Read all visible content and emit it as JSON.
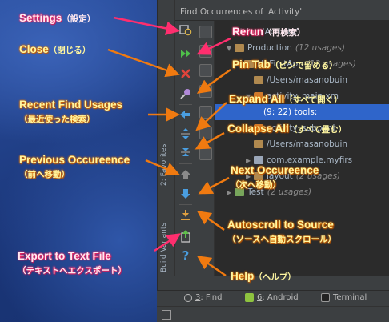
{
  "panel": {
    "title": "Find Occurrences of 'Activity'",
    "vertical_tabs": [
      "2: Favorites",
      "Build Variants"
    ]
  },
  "tree": {
    "rows": [
      {
        "indent": 1,
        "arrow": "",
        "icon": "none",
        "label": "String 'Activity'",
        "usage": "",
        "selected": false
      },
      {
        "indent": 1,
        "arrow": "▼",
        "icon": "folder",
        "label": "Production",
        "usage": "(12 usages)",
        "selected": false
      },
      {
        "indent": 2,
        "arrow": "▼",
        "icon": "folder",
        "label": "MyFirstApp",
        "usage": "(12 usages)",
        "selected": false
      },
      {
        "indent": 3,
        "arrow": "",
        "icon": "folder",
        "label": "/Users/masanobuin",
        "usage": "",
        "selected": false
      },
      {
        "indent": 3,
        "arrow": "▼",
        "icon": "file",
        "label": "activity_main.xm",
        "usage": "",
        "selected": false
      },
      {
        "indent": 4,
        "arrow": "",
        "icon": "none",
        "label": "(9: 22) tools:",
        "usage": "",
        "selected": true
      },
      {
        "indent": 3,
        "arrow": "▶",
        "icon": "file",
        "label": "activity_sub.xml",
        "usage": "",
        "selected": false
      },
      {
        "indent": 3,
        "arrow": "",
        "icon": "folder",
        "label": "/Users/masanobuin",
        "usage": "",
        "selected": false
      },
      {
        "indent": 3,
        "arrow": "▶",
        "icon": "pkg",
        "label": "com.example.myfirs",
        "usage": "",
        "selected": false
      },
      {
        "indent": 3,
        "arrow": "▶",
        "icon": "folder",
        "label": "layout",
        "usage": "(2 usages)",
        "selected": false
      },
      {
        "indent": 1,
        "arrow": "▶",
        "icon": "test",
        "label": "Test",
        "usage": "(2 usages)",
        "selected": false
      }
    ]
  },
  "bottom_tabs": [
    {
      "num": "3",
      "label": ": Find",
      "icon": "find-icon"
    },
    {
      "num": "6",
      "label": ": Android",
      "icon": "android-icon"
    },
    {
      "num": "",
      "label": "Terminal",
      "icon": "terminal-icon"
    }
  ],
  "toolbar_buttons": [
    {
      "name": "settings",
      "glyph": "⚙",
      "color": "#b9bcc0"
    },
    {
      "name": "rerun",
      "glyph": "▶▶",
      "color": "#4fbf4a"
    },
    {
      "name": "close",
      "glyph": "✕",
      "color": "#e0443c"
    },
    {
      "name": "pin-tab",
      "glyph": "📌",
      "color": "#b088d8"
    },
    {
      "name": "recent-find-usages",
      "glyph": "⇦",
      "color": "#4a9ee0"
    },
    {
      "name": "expand-all",
      "glyph": "⇕",
      "color": "#4a9ee0"
    },
    {
      "name": "collapse-all",
      "glyph": "⇳",
      "color": "#4a9ee0"
    },
    {
      "name": "previous-occurrence",
      "glyph": "↑",
      "color": "#9a9a9a"
    },
    {
      "name": "next-occurrence",
      "glyph": "↓",
      "color": "#4a9ee0"
    },
    {
      "name": "autoscroll-to-source",
      "glyph": "⤓",
      "color": "#e0a040"
    },
    {
      "name": "export-to-text-file",
      "glyph": "⇪",
      "color": "#5fbf4a"
    },
    {
      "name": "help",
      "glyph": "?",
      "color": "#4a9ee0"
    }
  ],
  "annotations": {
    "settings": {
      "en": "Settings",
      "ja": "（設定）"
    },
    "close": {
      "en": "Close",
      "ja": "（閉じる）"
    },
    "recent_find_usages": {
      "en": "Recent Find Usages",
      "ja": "（最近使った検索）"
    },
    "previous_occurrence": {
      "en": "Previous Occureence",
      "ja": "（前へ移動）"
    },
    "export_to_text_file": {
      "en": "Export to Text File",
      "ja": "（テキストへエクスポート）"
    },
    "rerun": {
      "en": "Rerun",
      "ja": "（再検索）"
    },
    "pin_tab": {
      "en": "Pin Tab",
      "ja": "（ピンで留める）"
    },
    "expand_all": {
      "en": "Expand All",
      "ja": "（すべて開く）"
    },
    "collapse_all": {
      "en": "Collapse All",
      "ja": "（すべて畳む）"
    },
    "next_occurrence": {
      "en": "Next Occureence",
      "ja": "（次へ移動）"
    },
    "autoscroll_to_source": {
      "en": "Autoscroll to Source",
      "ja": "（ソースへ自動スクロール）"
    },
    "help": {
      "en": "Help",
      "ja": "（ヘルプ）"
    }
  },
  "colors": {
    "annotation_orange": "#f07a10",
    "annotation_pink": "#ff2e6e",
    "selection": "#2f65ca",
    "desktop": "#1f3f86"
  }
}
